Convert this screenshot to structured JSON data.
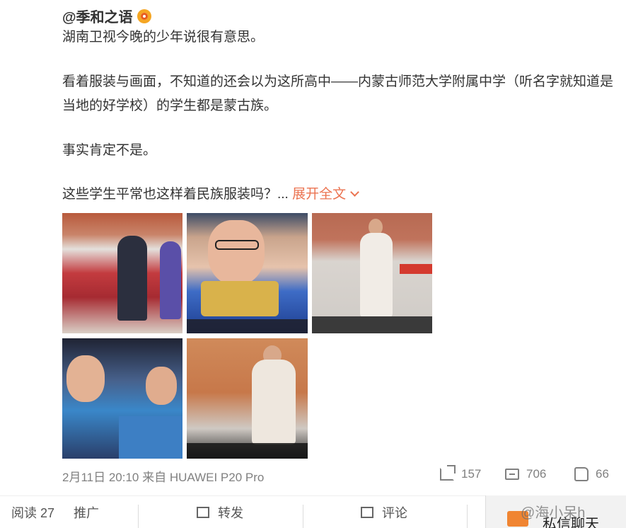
{
  "author": {
    "name": "@季和之语",
    "badge_icon": "verified-badge-icon"
  },
  "post": {
    "lines": [
      "湖南卫视今晚的少年说很有意思。",
      "看着服装与画面，不知道的还会以为这所高中——内蒙古师范大学附属中学（听名字就知道是",
      "当地的好学校）的学生都是蒙古族。",
      "事实肯定不是。",
      "这些学生平常也这样着民族服装吗？..."
    ],
    "expand_label": "展开全文"
  },
  "images": [
    {
      "name": "photo-students-group"
    },
    {
      "name": "photo-boy-glasses"
    },
    {
      "name": "photo-student-standing"
    },
    {
      "name": "photo-girls-clapping"
    },
    {
      "name": "photo-student-robe"
    }
  ],
  "meta": {
    "time_source": "2月11日 20:10 来自 HUAWEI P20 Pro"
  },
  "stats": {
    "reposts": "157",
    "comments": "706",
    "likes": "66"
  },
  "bottom_bar": {
    "reads": "阅读 27",
    "promote": "推广",
    "repost": "转发",
    "comment": "评论",
    "chat": "私信聊天"
  },
  "watermark": "@海小呆h",
  "colors": {
    "link": "#eb7350",
    "chat_icon": "#f08532"
  }
}
